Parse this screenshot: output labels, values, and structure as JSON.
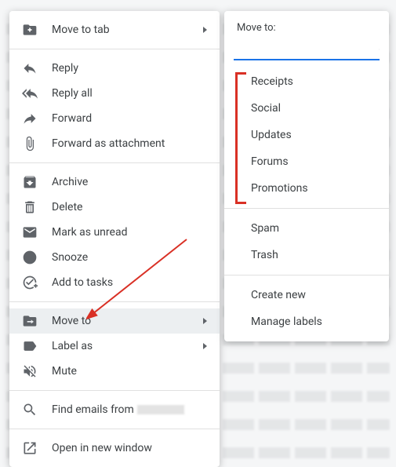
{
  "contextMenu": {
    "moveToTab": "Move to tab",
    "reply": "Reply",
    "replyAll": "Reply all",
    "forward": "Forward",
    "forwardAttachment": "Forward as attachment",
    "archive": "Archive",
    "delete": "Delete",
    "markUnread": "Mark as unread",
    "snooze": "Snooze",
    "addToTasks": "Add to tasks",
    "moveTo": "Move to",
    "labelAs": "Label as",
    "mute": "Mute",
    "findEmails": "Find emails from",
    "openNewWindow": "Open in new window"
  },
  "submenu": {
    "title": "Move to:",
    "searchPlaceholder": "",
    "labels": [
      "Receipts",
      "Social",
      "Updates",
      "Forums",
      "Promotions"
    ],
    "system": [
      "Spam",
      "Trash"
    ],
    "actions": [
      "Create new",
      "Manage labels"
    ]
  }
}
